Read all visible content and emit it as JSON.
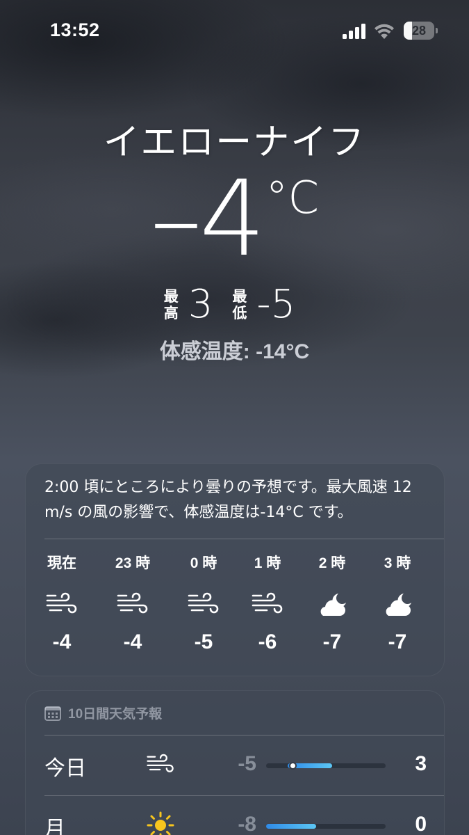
{
  "status_bar": {
    "time": "13:52",
    "battery_level": "28",
    "icons": [
      "signal-icon",
      "wifi-icon",
      "battery-icon"
    ]
  },
  "current": {
    "location": "イエローナイフ",
    "temperature": "–4",
    "unit": "°C",
    "high_label_1": "最",
    "high_label_2": "高",
    "high": "3",
    "low_label_1": "最",
    "low_label_2": "低",
    "low": "-5",
    "feels_like": "体感温度: -14°C"
  },
  "hourly": {
    "summary": "2:00 頃にところにより曇りの予想です。最大風速 12 m/s の風の影響で、体感温度は-14°C です。",
    "hours": [
      {
        "label": "現在",
        "icon": "wind-icon",
        "temp": "-4"
      },
      {
        "label": "23 時",
        "icon": "wind-icon",
        "temp": "-4"
      },
      {
        "label": "0 時",
        "icon": "wind-icon",
        "temp": "-5"
      },
      {
        "label": "1 時",
        "icon": "wind-icon",
        "temp": "-6"
      },
      {
        "label": "2 時",
        "icon": "cloud-moon-icon",
        "temp": "-7"
      },
      {
        "label": "3 時",
        "icon": "cloud-moon-icon",
        "temp": "-7"
      }
    ]
  },
  "daily": {
    "title": "10日間天気予報",
    "header_icon": "calendar-icon",
    "days": [
      {
        "name": "今日",
        "icon": "wind-icon",
        "low": "-5",
        "high": "3",
        "range_start": 0.18,
        "range_end": 0.55,
        "current_marker": 0.22
      },
      {
        "name": "月",
        "icon": "sun-icon",
        "low": "-8",
        "high": "0",
        "range_start": 0.0,
        "range_end": 0.42
      }
    ]
  },
  "colors": {
    "range_fill_start": "#2f8be8",
    "range_fill_end": "#5cc7f5",
    "sun": "#f7c51e"
  }
}
